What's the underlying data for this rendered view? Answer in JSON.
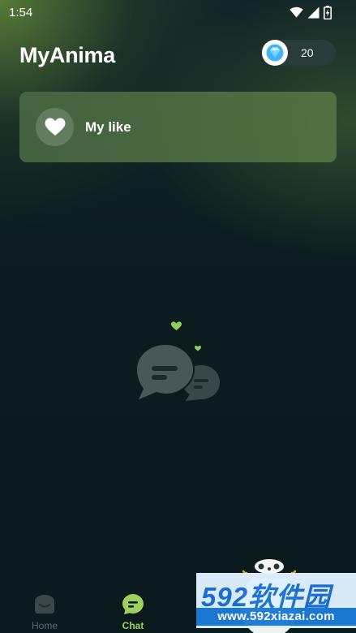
{
  "status_bar": {
    "time": "1:54",
    "icons": [
      "wifi-icon",
      "cellular-signal-icon",
      "battery-charging-icon"
    ]
  },
  "header": {
    "title": "MyAnima",
    "gem_count": "20",
    "gem_icon": "diamond-icon"
  },
  "like_card": {
    "label": "My like",
    "icon": "heart-icon"
  },
  "empty_state": {
    "icon": "chat-bubbles-hearts-icon"
  },
  "bottom_nav": {
    "items": [
      {
        "label": "Home",
        "icon": "home-icon",
        "active": false
      },
      {
        "label": "Chat",
        "icon": "chat-icon",
        "active": true
      }
    ]
  },
  "watermark": {
    "main": "592软件园",
    "url": "www.592xiazai.com"
  },
  "colors": {
    "background": "#0c1c1f",
    "accent": "#9ed05e",
    "card": "#4c6a42",
    "inactive": "#5a6b6d",
    "watermark_blue": "#1b6fd6"
  }
}
